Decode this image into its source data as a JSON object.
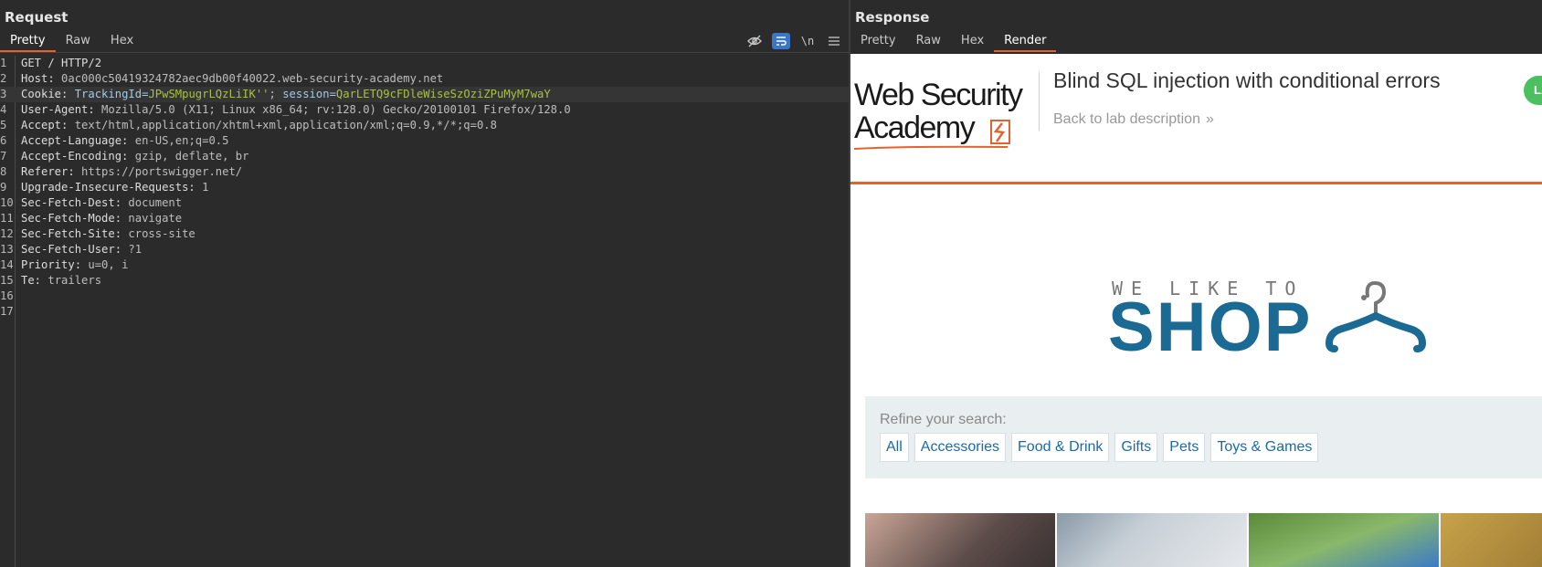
{
  "request": {
    "title": "Request",
    "tabs": [
      "Pretty",
      "Raw",
      "Hex"
    ],
    "active_tab": "Pretty",
    "tools": {
      "hide_icon": "eye-off-icon",
      "wrap_icon": "wrap-lines-icon",
      "newline_label": "\\n",
      "menu_icon": "hamburger-menu-icon"
    },
    "lines": [
      {
        "n": "1",
        "k": "GET / HTTP/2",
        "v": ""
      },
      {
        "n": "2",
        "k": "Host:",
        "v": " 0ac000c50419324782aec9db00f40022.web-security-academy.net"
      },
      {
        "n": "3",
        "cookie": true,
        "k": "Cookie:",
        "c1k": " TrackingId=",
        "c1v": "JPwSMpugrLQzLiIK''",
        "sep": "; ",
        "c2k": "session=",
        "c2v": "QarLETQ9cFDleWiseSzOziZPuMyM7waY"
      },
      {
        "n": "4",
        "k": "User-Agent:",
        "v": " Mozilla/5.0 (X11; Linux x86_64; rv:128.0) Gecko/20100101 Firefox/128.0"
      },
      {
        "n": "5",
        "k": "Accept:",
        "v": " text/html,application/xhtml+xml,application/xml;q=0.9,*/*;q=0.8"
      },
      {
        "n": "6",
        "k": "Accept-Language:",
        "v": " en-US,en;q=0.5"
      },
      {
        "n": "7",
        "k": "Accept-Encoding:",
        "v": " gzip, deflate, br"
      },
      {
        "n": "8",
        "k": "Referer:",
        "v": " https://portswigger.net/"
      },
      {
        "n": "9",
        "k": "Upgrade-Insecure-Requests:",
        "v": " 1"
      },
      {
        "n": "10",
        "k": "Sec-Fetch-Dest:",
        "v": " document"
      },
      {
        "n": "11",
        "k": "Sec-Fetch-Mode:",
        "v": " navigate"
      },
      {
        "n": "12",
        "k": "Sec-Fetch-Site:",
        "v": " cross-site"
      },
      {
        "n": "13",
        "k": "Sec-Fetch-User:",
        "v": " ?1"
      },
      {
        "n": "14",
        "k": "Priority:",
        "v": " u=0, i"
      },
      {
        "n": "15",
        "k": "Te:",
        "v": " trailers"
      },
      {
        "n": "16",
        "k": "",
        "v": ""
      },
      {
        "n": "17",
        "k": "",
        "v": ""
      }
    ]
  },
  "response": {
    "title": "Response",
    "tabs": [
      "Pretty",
      "Raw",
      "Hex",
      "Render"
    ],
    "active_tab": "Render",
    "render": {
      "logo_line1": "Web Security",
      "logo_line2": "Academy",
      "lab_title": "Blind SQL injection with conditional errors",
      "back_link": "Back to lab description",
      "status_text": "LA",
      "tagline": "WE LIKE TO",
      "shop": "SHOP",
      "refine_label": "Refine your search:",
      "filters": [
        "All",
        "Accessories",
        "Food & Drink",
        "Gifts",
        "Pets",
        "Toys & Games"
      ]
    }
  },
  "colors": {
    "accent": "#e8612c",
    "shop_blue": "#1a6a94",
    "link_blue": "#1a6aa8",
    "cookie_value": "#a8c23c"
  }
}
